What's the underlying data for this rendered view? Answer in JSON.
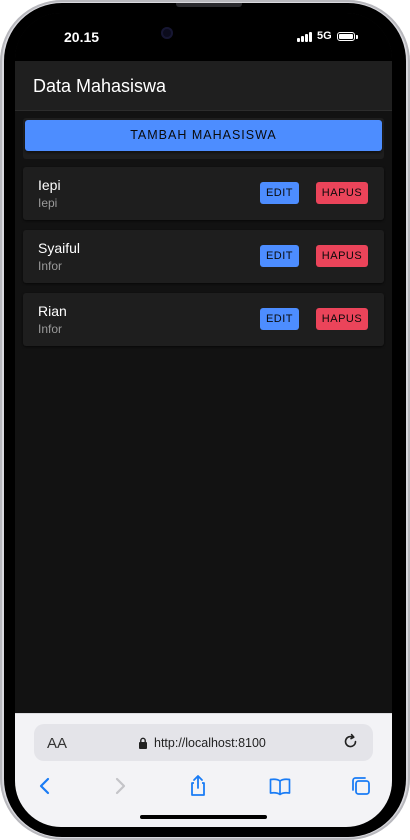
{
  "status_bar": {
    "time": "20.15",
    "network": "5G"
  },
  "toolbar": {
    "title": "Data Mahasiswa"
  },
  "actions": {
    "add_label": "TAMBAH MAHASISWA"
  },
  "students": [
    {
      "name": "Iepi",
      "subtitle": "Iepi",
      "edit_label": "EDIT",
      "delete_label": "HAPUS"
    },
    {
      "name": "Syaiful",
      "subtitle": "Infor",
      "edit_label": "EDIT",
      "delete_label": "HAPUS"
    },
    {
      "name": "Rian",
      "subtitle": "Infor",
      "edit_label": "EDIT",
      "delete_label": "HAPUS"
    }
  ],
  "browser": {
    "text_size_label": "AA",
    "url": "http://localhost:8100",
    "icons": [
      "text-size-icon",
      "lock-icon",
      "reload-icon",
      "back-icon",
      "forward-icon",
      "share-icon",
      "bookmarks-icon",
      "tabs-icon"
    ]
  },
  "colors": {
    "primary": "#4d8dff",
    "danger": "#eb445a",
    "background": "#121212",
    "item_background": "#1e1e1e",
    "toolbar_background": "#1f1f1f",
    "browser_accent": "#1a7cf5"
  }
}
